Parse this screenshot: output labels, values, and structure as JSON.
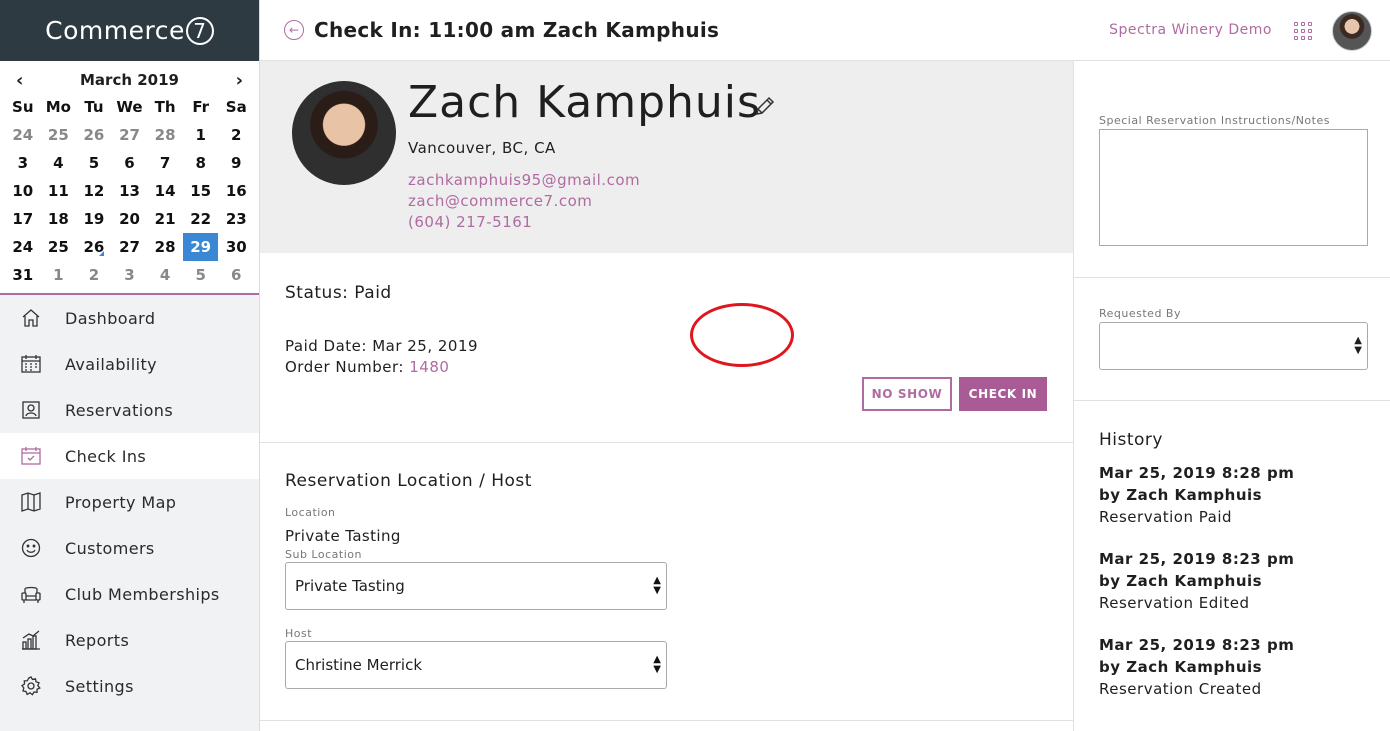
{
  "app": {
    "logo_text": "Commerce",
    "logo_mark": "7"
  },
  "header": {
    "title_prefix": "Check In:",
    "title_main": "11:00 am Zach Kamphuis",
    "store_name": "Spectra Winery Demo"
  },
  "calendar": {
    "month_label": "March 2019",
    "prev": "‹",
    "next": "›",
    "weekdays": [
      "Su",
      "Mo",
      "Tu",
      "We",
      "Th",
      "Fr",
      "Sa"
    ],
    "weeks": [
      [
        "24",
        "25",
        "26",
        "27",
        "28",
        "1",
        "2"
      ],
      [
        "3",
        "4",
        "5",
        "6",
        "7",
        "8",
        "9"
      ],
      [
        "10",
        "11",
        "12",
        "13",
        "14",
        "15",
        "16"
      ],
      [
        "17",
        "18",
        "19",
        "20",
        "21",
        "22",
        "23"
      ],
      [
        "24",
        "25",
        "26",
        "27",
        "28",
        "29",
        "30"
      ],
      [
        "31",
        "1",
        "2",
        "3",
        "4",
        "5",
        "6"
      ]
    ],
    "selected_day": "29"
  },
  "sidebar": {
    "items": [
      {
        "label": "Dashboard",
        "icon": "home-icon"
      },
      {
        "label": "Availability",
        "icon": "calendar-grid-icon"
      },
      {
        "label": "Reservations",
        "icon": "reservation-card-icon"
      },
      {
        "label": "Check Ins",
        "icon": "calendar-check-icon",
        "active": true
      },
      {
        "label": "Property Map",
        "icon": "map-icon"
      },
      {
        "label": "Customers",
        "icon": "smiley-icon"
      },
      {
        "label": "Club Memberships",
        "icon": "sofa-icon"
      },
      {
        "label": "Reports",
        "icon": "bar-chart-icon"
      },
      {
        "label": "Settings",
        "icon": "gear-icon"
      }
    ]
  },
  "customer": {
    "name": "Zach Kamphuis",
    "location": "Vancouver, BC, CA",
    "email1": "zachkamphuis95@gmail.com",
    "email2": "zach@commerce7.com",
    "phone": "(604) 217-5161"
  },
  "status": {
    "status_text": "Status: Paid",
    "paid_date": "Paid Date: Mar 25, 2019",
    "order_label": "Order Number:",
    "order_number": "1480",
    "no_show_label": "NO SHOW",
    "check_in_label": "CHECK IN"
  },
  "location": {
    "section_title": "Reservation Location / Host",
    "location_label": "Location",
    "location_value": "Private Tasting",
    "sub_location_label": "Sub Location",
    "sub_location_value": "Private Tasting",
    "host_label": "Host",
    "host_value": "Christine Merrick"
  },
  "right_panel": {
    "notes_label": "Special Reservation Instructions/Notes",
    "requested_by_label": "Requested By",
    "requested_by_value": "",
    "history_title": "History",
    "history": [
      {
        "date": "Mar 25, 2019 8:28 pm",
        "by": "by Zach Kamphuis",
        "action": "Reservation Paid"
      },
      {
        "date": "Mar 25, 2019 8:23 pm",
        "by": "by Zach Kamphuis",
        "action": "Reservation Edited"
      },
      {
        "date": "Mar 25, 2019 8:23 pm",
        "by": "by Zach Kamphuis",
        "action": "Reservation Created"
      }
    ]
  },
  "colors": {
    "accent": "#b06ba1",
    "button": "#a85b94",
    "sidebar_dark": "#2e3a42",
    "today": "#3a87d4",
    "highlight_ring": "#e0161e"
  }
}
